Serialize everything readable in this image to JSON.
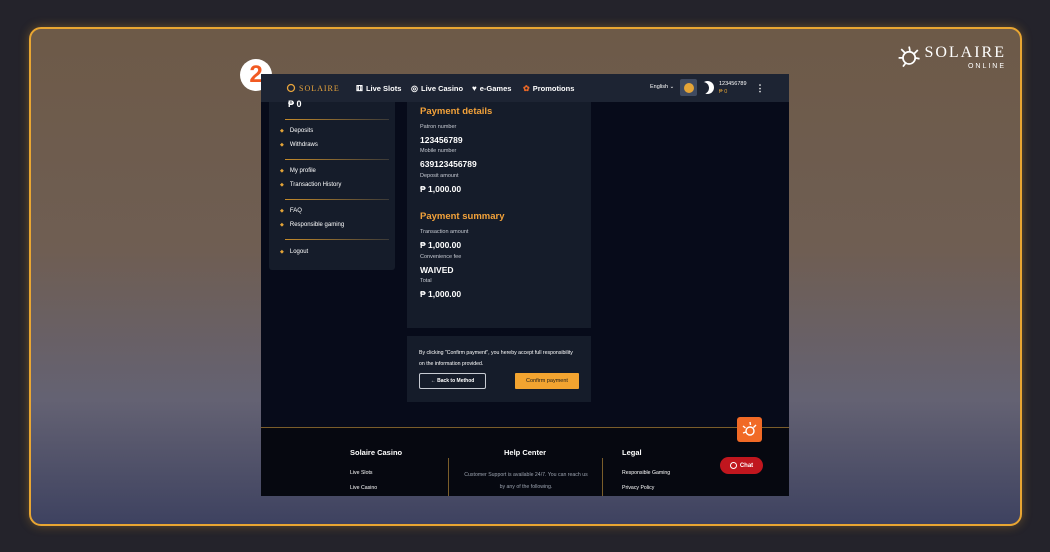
{
  "brand": {
    "name": "SOLAIRE",
    "tag": "ONLINE"
  },
  "step": "2",
  "topbar": {
    "logo": "SOLAIRE",
    "nav": [
      {
        "label": "Live Slots",
        "icon": "slot-machine-icon",
        "glyph": "⚅"
      },
      {
        "label": "Live Casino",
        "icon": "chip-icon",
        "glyph": "◎"
      },
      {
        "label": "e-Games",
        "icon": "heart-icon",
        "glyph": "♥"
      },
      {
        "label": "Promotions",
        "icon": "gift-icon",
        "glyph": "✿"
      }
    ],
    "language": "English ⌄",
    "account_number": "123456789",
    "balance": "₱ 0",
    "more": "⋮"
  },
  "sidebar": {
    "top_text": "₱ 0",
    "items": [
      {
        "label": "Deposits"
      },
      {
        "label": "Withdraws"
      },
      {
        "label": "My profile"
      },
      {
        "label": "Transaction History"
      },
      {
        "label": "FAQ"
      },
      {
        "label": "Responsible gaming"
      },
      {
        "label": "Logout"
      }
    ]
  },
  "payment_details": {
    "title": "Payment details",
    "patron_label": "Patron number",
    "patron_value": "123456789",
    "mobile_label": "Mobile number",
    "mobile_value": "639123456789",
    "deposit_label": "Deposit amount",
    "deposit_value": "₱ 1,000.00"
  },
  "payment_summary": {
    "title": "Payment summary",
    "txn_label": "Transaction amount",
    "txn_value": "₱ 1,000.00",
    "fee_label": "Convenience fee",
    "fee_value": "WAIVED",
    "total_label": "Total",
    "total_value": "₱ 1,000.00"
  },
  "confirm": {
    "disclaimer": "By clicking \"Confirm payment\", you hereby accept full responsibility on the information provided.",
    "back_label": "← Back to Method",
    "confirm_label": "Confirm payment"
  },
  "footer": {
    "col1_title": "Solaire Casino",
    "col1_links": [
      "Live Slots",
      "Live Casino"
    ],
    "col2_title": "Help Center",
    "col2_text": "Customer Support is available 24/7. You can reach us by any of the following.",
    "col3_title": "Legal",
    "col3_links": [
      "Responsible Gaming",
      "Privacy Policy"
    ],
    "chat_label": "Chat"
  },
  "colors": {
    "accent": "#f3a430",
    "frame": "#e9a632",
    "chat": "#c0161e"
  }
}
